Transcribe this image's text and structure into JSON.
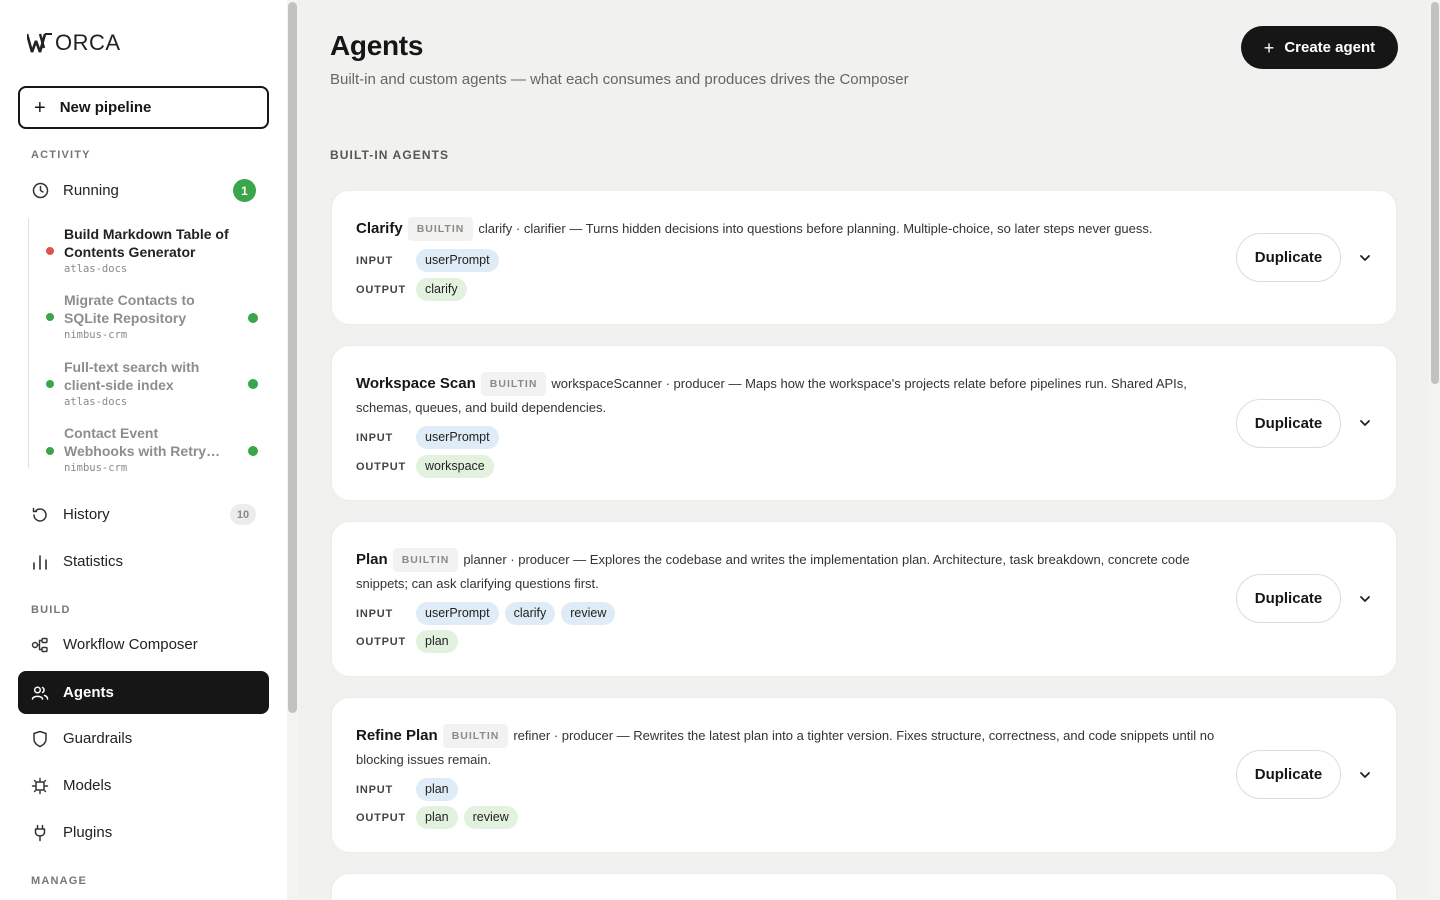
{
  "brand": {
    "logo_text": "ORCA"
  },
  "sidebar": {
    "new_pipeline": "New pipeline",
    "activity_label": "ACTIVITY",
    "running": {
      "label": "Running",
      "count": "1"
    },
    "runs": [
      {
        "title": "Build Markdown Table of Contents Generator",
        "project": "atlas-docs",
        "status": "error"
      },
      {
        "title": "Migrate Contacts to SQLite Repository",
        "project": "nimbus-crm",
        "status": "done"
      },
      {
        "title": "Full-text search with client-side index",
        "project": "atlas-docs",
        "status": "done"
      },
      {
        "title": "Contact Event Webhooks with Retry…",
        "project": "nimbus-crm",
        "status": "done"
      }
    ],
    "history": {
      "label": "History",
      "count": "10"
    },
    "statistics": {
      "label": "Statistics"
    },
    "build_label": "BUILD",
    "workflow_composer": {
      "label": "Workflow Composer"
    },
    "agents": {
      "label": "Agents"
    },
    "guardrails": {
      "label": "Guardrails"
    },
    "models": {
      "label": "Models"
    },
    "plugins": {
      "label": "Plugins"
    },
    "manage_label": "MANAGE"
  },
  "main": {
    "title": "Agents",
    "subtitle": "Built-in and custom agents — what each consumes and produces drives the Composer",
    "create_button": "Create agent",
    "section_title": "BUILT-IN AGENTS",
    "input_label": "INPUT",
    "output_label": "OUTPUT",
    "builtin_badge": "BUILTIN",
    "duplicate_label": "Duplicate",
    "agents": [
      {
        "name": "Clarify",
        "description": "clarify · clarifier — Turns hidden decisions into questions before planning. Multiple-choice, so later steps never guess.",
        "inputs": [
          "userPrompt"
        ],
        "outputs": [
          "clarify"
        ]
      },
      {
        "name": "Workspace Scan",
        "description": "workspaceScanner · producer — Maps how the workspace's projects relate before pipelines run. Shared APIs, schemas, queues, and build dependencies.",
        "inputs": [
          "userPrompt"
        ],
        "outputs": [
          "workspace"
        ]
      },
      {
        "name": "Plan",
        "description": "planner · producer — Explores the codebase and writes the implementation plan. Architecture, task breakdown, concrete code snippets; can ask clarifying questions first.",
        "inputs": [
          "userPrompt",
          "clarify",
          "review"
        ],
        "outputs": [
          "plan"
        ]
      },
      {
        "name": "Refine Plan",
        "description": "refiner · producer — Rewrites the latest plan into a tighter version. Fixes structure, correctness, and code snippets until no blocking issues remain.",
        "inputs": [
          "plan"
        ],
        "outputs": [
          "plan",
          "review"
        ]
      }
    ]
  }
}
